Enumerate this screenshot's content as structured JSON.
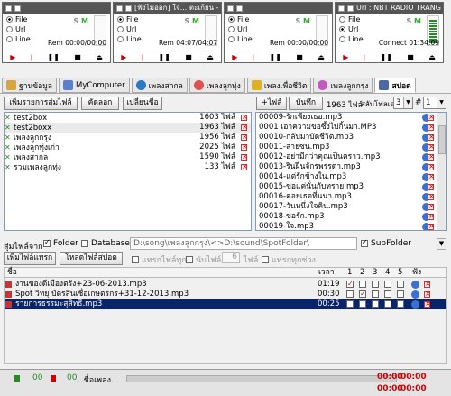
{
  "decks": [
    {
      "title": "",
      "opts": [
        "File",
        "Url",
        "Line"
      ],
      "sel": 0,
      "sm_s": "S",
      "sm_m": "M",
      "time_label": "Rem",
      "time": "00:00/00:00"
    },
    {
      "title": "[ฟังไม่ออก] ใจ... ตะเกียน - 08 -",
      "opts": [
        "File",
        "Url",
        "Line"
      ],
      "sel": 0,
      "sm_s": "S",
      "sm_m": "M",
      "time_label": "Rem",
      "time": "04:07/04:07"
    },
    {
      "title": "",
      "opts": [
        "File",
        "Url",
        "Line"
      ],
      "sel": 0,
      "sm_s": "S",
      "sm_m": "M",
      "time_label": "Rem",
      "time": "00:00/00:00"
    },
    {
      "title": "Url : NBT RADIO TRANG F.M. 91.50",
      "opts": [
        "File",
        "Url",
        "Line"
      ],
      "sel": 1,
      "sm_s": "S",
      "sm_m": "M",
      "time_label": "Connect",
      "time": "01:34:09"
    }
  ],
  "tabs": [
    "ฐานข้อมูล",
    "MyComputer",
    "เพลงสากล",
    "เพลงลูกทุ่ง",
    "เพลงเพื่อชีวิต",
    "เพลงลูกกรุง",
    "สปอต"
  ],
  "active_tab": 6,
  "toolbar": {
    "random_list": "เพิ่มรายการสุ่มไฟล์",
    "copy": "คัดลอก",
    "rename": "เปลี่ยนชื่อ",
    "add_file": "+ไฟล์",
    "save": "บันทึก",
    "file_count": "1963 ไฟล์",
    "speaker_label": "สลับโฟลเดอร์",
    "speaker_val": "3",
    "hash_label": "#",
    "hash_val": "1"
  },
  "folders": [
    {
      "name": "test2box",
      "count": "1603 ไฟล์",
      "selected": false
    },
    {
      "name": "test2boxx",
      "count": "1963 ไฟล์",
      "selected": true
    },
    {
      "name": "เพลงลูกกรุง",
      "count": "1956 ไฟล์",
      "selected": false
    },
    {
      "name": "เพลงลูกทุ่งเก่า",
      "count": "2025 ไฟล์",
      "selected": false
    },
    {
      "name": "เพลงสากล",
      "count": "1590 ไฟล์",
      "selected": false
    },
    {
      "name": "รวมเพลงลูกทุ่ง",
      "count": "133 ไฟล์",
      "selected": false
    }
  ],
  "files": [
    "00009-รักเพียงเธอ.mp3",
    "0001 เอาความขอซึ้งไปกิ้นมา.MP3",
    "00010-กลับมาบัดชีวิต.mp3",
    "00011-สายซน.mp3",
    "00012-อย่ามีกว่าคุณเป็นคราว.mp3",
    "00013-รินฝีนจักรพรรดา.mp3",
    "00014-แต่รักข้างใน.mp3",
    "00015-ขอแค่นั่นกับทราย.mp3",
    "00016-คอยเธอที่นนา.mp3",
    "00017-วันหนึ่งใจคิน.mp3",
    "00018-ขอรัก.mp3",
    "00019-ใจ.mp3"
  ],
  "random": {
    "label": "สุ่มไฟล์จาก",
    "folder_label": "Folder",
    "database_label": "Database",
    "path": "D:\\song\\เพลงลูกกรุง\\<>D:\\sound\\SpotFolder\\",
    "subfolder": "SubFolder",
    "add_list": "เพิ่มไฟล์แทรก",
    "load_spot": "โหลดไฟล์สปอต",
    "opt_a": "แทรกไฟล์ทุก",
    "opt_b": "นับไฟล์",
    "opt_count": "6",
    "opt_unit": "ไฟล์",
    "opt_c": "แทรกทุกช่วง"
  },
  "table": {
    "col_name": "ชื่อ",
    "col_time": "เวลา",
    "col_nums": [
      "1",
      "2",
      "3",
      "4",
      "5"
    ],
    "col_listen": "ฟัง",
    "rows": [
      {
        "name": "งานของดีเมืองตรัง+23-06-2013.mp3",
        "time": "01:19",
        "checks": [
          true,
          false,
          false,
          false,
          false
        ],
        "hl": false
      },
      {
        "name": "Spot วิทยุ บัตรสินเชื่อเกษตรกร+31-12-2013.mp3",
        "time": "00:30",
        "checks": [
          false,
          true,
          false,
          false,
          false
        ],
        "hl": false
      },
      {
        "name": "รายการธรรมะสุสิทธิ์.mp3",
        "time": "00:25",
        "checks": [
          false,
          false,
          false,
          false,
          false
        ],
        "hl": true
      }
    ]
  },
  "status": {
    "left_a": "00",
    "left_b": "00",
    "center": "...ชื่อเพลง...",
    "right_a": "00:00",
    "right_b": "00:00",
    "right_top": "00:00",
    "right_bottom": "00:00"
  }
}
